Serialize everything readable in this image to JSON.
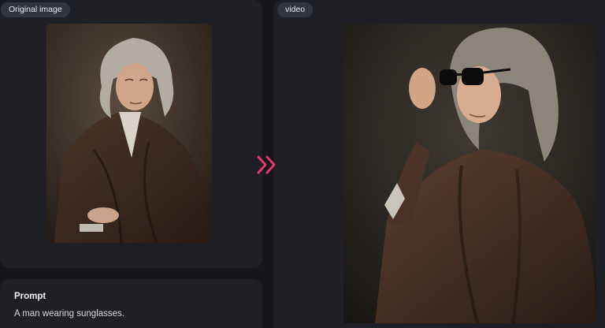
{
  "left_panel": {
    "label": "Original image",
    "image_icon": "portrait-image"
  },
  "right_panel": {
    "label": "video",
    "image_icon": "video-frame-image"
  },
  "transition": {
    "icon": "double-chevron-right-icon",
    "color": "#e8356b"
  },
  "prompt": {
    "title": "Prompt",
    "text": "A man wearing sunglasses."
  },
  "colors": {
    "background": "#16171b",
    "card": "#1f2026",
    "pill": "#33353c",
    "accent": "#e8356b"
  }
}
